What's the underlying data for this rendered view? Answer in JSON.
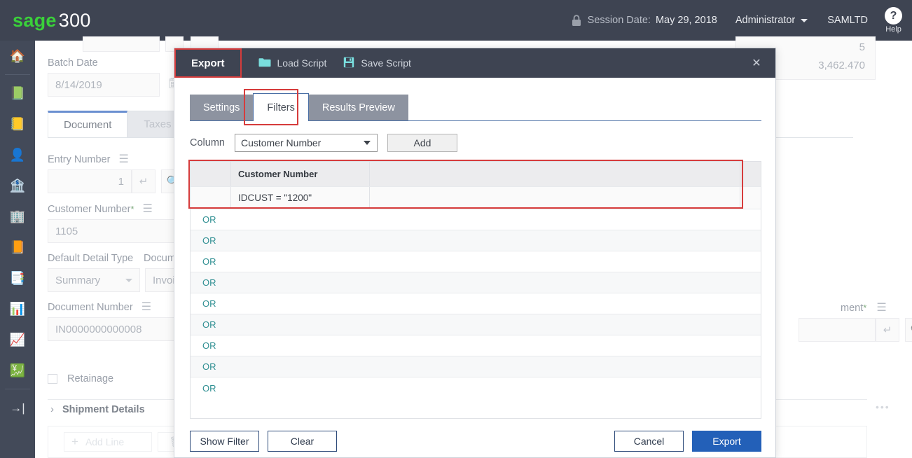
{
  "app": {
    "brand_sage": "sage",
    "brand_product": "300",
    "header": {
      "lock_icon": "lock-icon",
      "session_label": "Session Date:",
      "session_date": "May 29, 2018",
      "user": "Administrator",
      "company": "SAMLTD",
      "help_glyph": "?",
      "help_label": "Help"
    },
    "colors": {
      "header_bg": "#3e4452",
      "brand_green": "#3ad13a",
      "accent_blue": "#2360b8",
      "highlight_red": "#d63c3c",
      "tab_gray": "#8d93a0",
      "or_teal": "#2f8f92"
    }
  },
  "sidebar": {
    "items": [
      {
        "name": "home",
        "glyph": "🏠"
      },
      {
        "name": "accounts-payable",
        "glyph": "📗"
      },
      {
        "name": "accounts-receivable",
        "glyph": "📒"
      },
      {
        "name": "administrative-services",
        "glyph": "👤"
      },
      {
        "name": "bank-services",
        "glyph": "🏦"
      },
      {
        "name": "common-services",
        "glyph": "🏢"
      },
      {
        "name": "general-ledger",
        "glyph": "📙"
      },
      {
        "name": "inventory-control",
        "glyph": "📑"
      },
      {
        "name": "order-entry",
        "glyph": "📊"
      },
      {
        "name": "purchase-orders",
        "glyph": "📈"
      },
      {
        "name": "tax-services",
        "glyph": "💹"
      },
      {
        "name": "collapse-nav",
        "glyph": "→|"
      }
    ]
  },
  "background_form": {
    "batch_date": {
      "label": "Batch Date",
      "value": "8/14/2019",
      "icon": "calendar-icon"
    },
    "tabs": [
      {
        "label": "Document",
        "active": true
      },
      {
        "label": "Taxes",
        "active": false
      }
    ],
    "entry_number": {
      "label": "Entry Number",
      "value": "1",
      "menu_icon": "hamburger-icon",
      "go_icon": "enter-arrow-icon",
      "find_icon": "search-icon"
    },
    "customer_number": {
      "label": "Customer Number",
      "required": "*",
      "value": "1105",
      "menu_icon": "hamburger-icon"
    },
    "default_detail_type": {
      "label": "Default Detail Type",
      "value": "Summary"
    },
    "document_type": {
      "label": "Docum",
      "value": "Invoi"
    },
    "document_number": {
      "label": "Document Number",
      "value": "IN0000000000008",
      "menu_icon": "hamburger-icon"
    },
    "retainage": {
      "label": "Retainage",
      "checked": false
    },
    "shipment_details": {
      "label": "Shipment Details",
      "expander": "chevron-right-icon"
    },
    "detail_toolbar": {
      "add_line": "Add Line",
      "add_icon": "plus-icon",
      "delete_icon": "trash-icon"
    },
    "right_values": {
      "count": "5",
      "amount": "3,462.470"
    },
    "right_field": {
      "label": "ment",
      "required": "*",
      "menu_icon": "hamburger-icon",
      "go_icon": "enter-arrow-icon",
      "find_icon": "search-icon"
    },
    "overflow_menu": "•••"
  },
  "dialog": {
    "title": "Export",
    "actions": [
      {
        "label": "Load Script",
        "icon": "folder-icon"
      },
      {
        "label": "Save Script",
        "icon": "save-icon"
      }
    ],
    "close_icon": "✕",
    "tabs": [
      {
        "label": "Settings",
        "active": false
      },
      {
        "label": "Filters",
        "active": true
      },
      {
        "label": "Results Preview",
        "active": false
      }
    ],
    "column_row": {
      "label": "Column",
      "selected": "Customer Number",
      "dropdown_icon": "chevron-down-icon",
      "add_label": "Add"
    },
    "grid": {
      "headers": [
        "",
        "Customer Number",
        "",
        ""
      ],
      "condition_row": {
        "blank": "",
        "expression": "IDCUST = \"1200\""
      },
      "or_rows": [
        "OR",
        "OR",
        "OR",
        "OR",
        "OR",
        "OR",
        "OR",
        "OR",
        "OR"
      ]
    },
    "footer": {
      "show_filter": "Show Filter",
      "clear": "Clear",
      "cancel": "Cancel",
      "export": "Export"
    }
  }
}
